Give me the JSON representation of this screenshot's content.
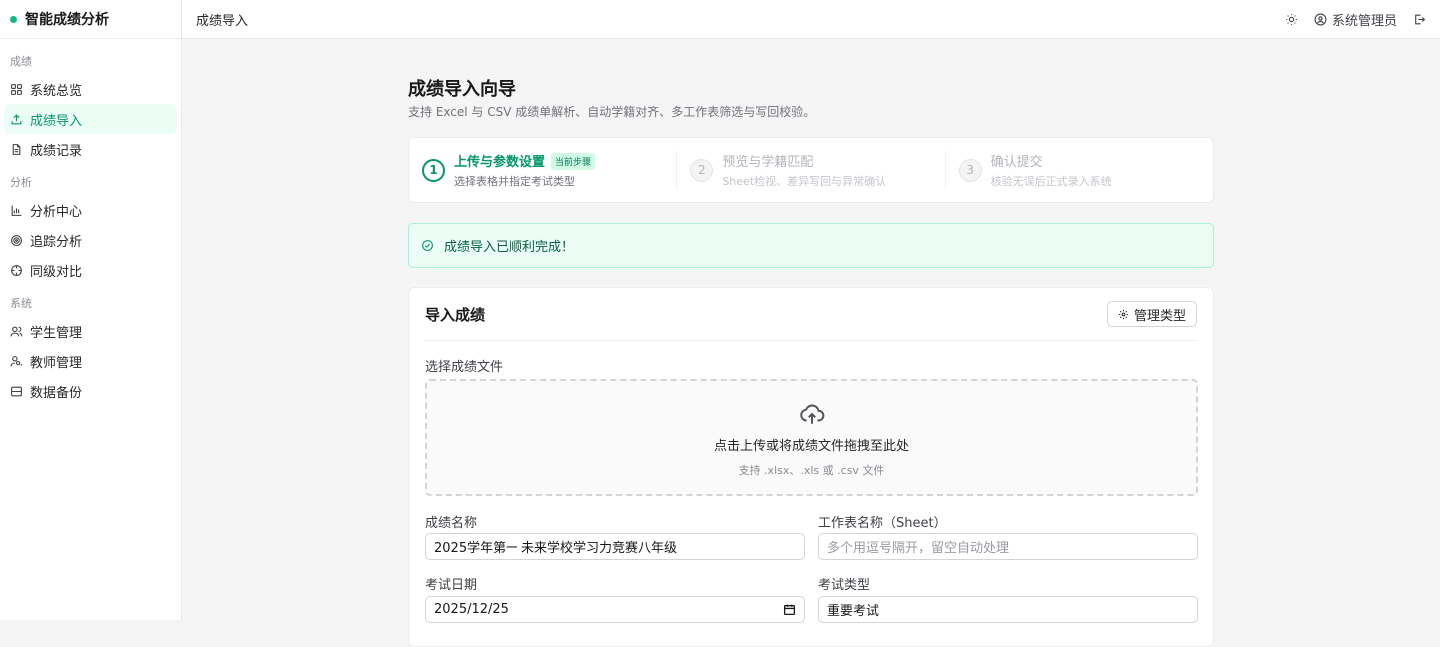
{
  "brand": {
    "name": "智能成绩分析",
    "accent": "#10b981"
  },
  "sidebar": {
    "groups": [
      {
        "label": "成绩",
        "items": [
          {
            "label": "系统总览",
            "icon": "grid-icon",
            "active": false
          },
          {
            "label": "成绩导入",
            "icon": "upload-icon",
            "active": true
          },
          {
            "label": "成绩记录",
            "icon": "file-text-icon",
            "active": false
          }
        ]
      },
      {
        "label": "分析",
        "items": [
          {
            "label": "分析中心",
            "icon": "bar-chart-icon",
            "active": false
          },
          {
            "label": "追踪分析",
            "icon": "target-icon",
            "active": false
          },
          {
            "label": "同级对比",
            "icon": "crosshair-icon",
            "active": false
          }
        ]
      },
      {
        "label": "系统",
        "items": [
          {
            "label": "学生管理",
            "icon": "users-icon",
            "active": false
          },
          {
            "label": "教师管理",
            "icon": "user-key-icon",
            "active": false
          },
          {
            "label": "数据备份",
            "icon": "database-icon",
            "active": false
          }
        ]
      }
    ]
  },
  "topbar": {
    "breadcrumb": "成绩导入",
    "user": "系统管理员"
  },
  "page": {
    "title": "成绩导入向导",
    "subtitle": "支持 Excel 与 CSV 成绩单解析、自动学籍对齐、多工作表筛选与写回校验。"
  },
  "steps": [
    {
      "num": "1",
      "name": "上传与参数设置",
      "badge": "当前步骤",
      "desc": "选择表格并指定考试类型",
      "active": true
    },
    {
      "num": "2",
      "name": "预览与学籍匹配",
      "desc": "Sheet检视、差异写回与异常确认",
      "active": false
    },
    {
      "num": "3",
      "name": "确认提交",
      "desc": "核验无误后正式录入系统",
      "active": false
    }
  ],
  "alert": {
    "text": "成绩导入已顺利完成！"
  },
  "form": {
    "card_title": "导入成绩",
    "manage_button": "管理类型",
    "file_label": "选择成绩文件",
    "drop_main": "点击上传或将成绩文件拖拽至此处",
    "drop_sub": "支持 .xlsx、.xls 或 .csv 文件",
    "name_label": "成绩名称",
    "name_value": "2025学年第一",
    "name_overlay": "未来学校学习力竞赛八年级",
    "sheet_label": "工作表名称（Sheet）",
    "sheet_placeholder": "多个用逗号隔开，留空自动处理",
    "date_label": "考试日期",
    "date_value": "2025/12/25",
    "type_label": "考试类型",
    "type_value": "重要考试"
  }
}
